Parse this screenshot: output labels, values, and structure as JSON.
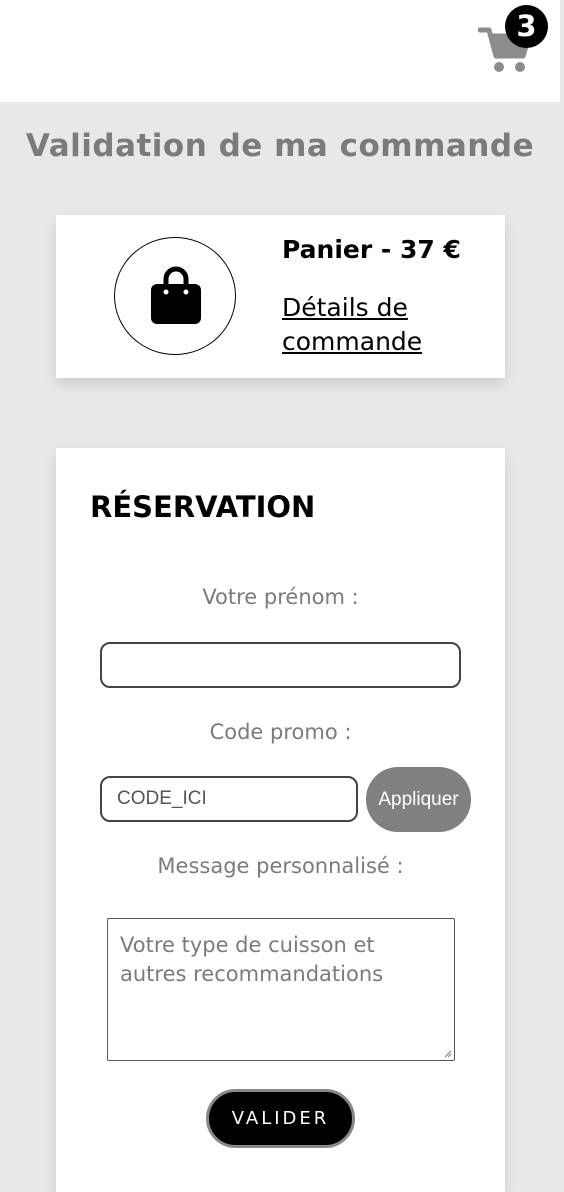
{
  "header": {
    "cart_icon": "shopping-cart-icon",
    "cart_count": "3"
  },
  "page": {
    "title": "Validation de ma commande"
  },
  "summary": {
    "bag_icon": "shopping-bag-icon",
    "cart_total": "Panier - 37 €",
    "details_link": "Détails de commande"
  },
  "form": {
    "title": "RÉSERVATION",
    "first_name_label": "Votre prénom :",
    "first_name_value": "",
    "promo_label": "Code promo :",
    "promo_value": "CODE_ICI",
    "apply_label": "Appliquer",
    "message_label": "Message personnalisé :",
    "message_placeholder": "Votre type de cuisson et autres recommandations",
    "submit_label": "VALIDER"
  },
  "colors": {
    "background": "#e8e8e8",
    "title_gray": "#7b7b7b",
    "apply_button": "#808080",
    "submit_button": "#000000"
  }
}
